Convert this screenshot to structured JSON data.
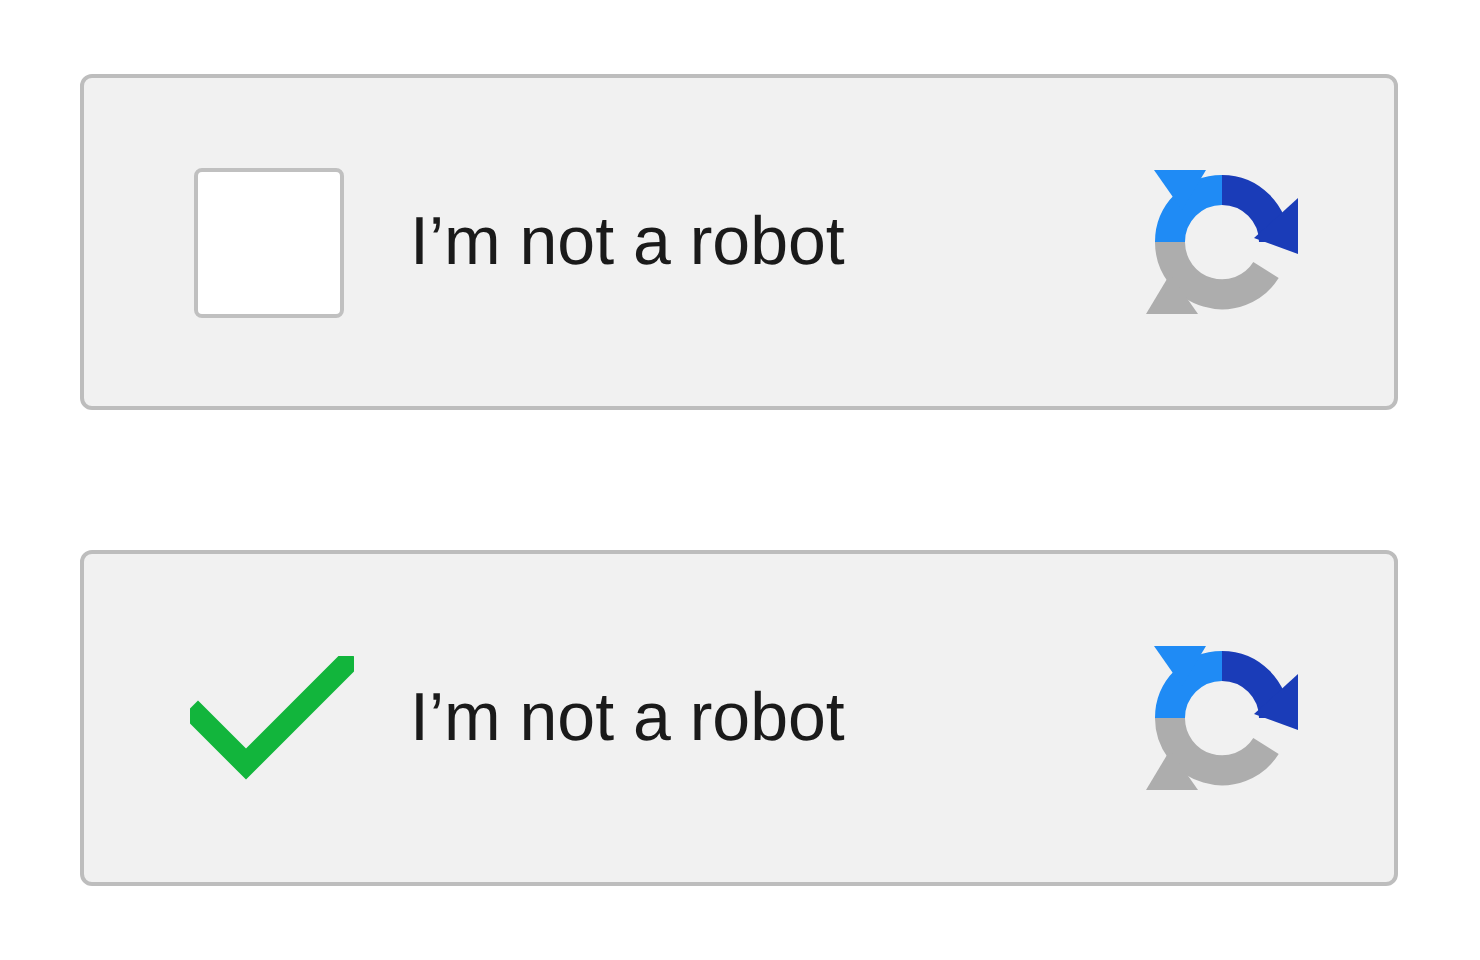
{
  "widgets": [
    {
      "label": "I’m not a robot",
      "checked": false
    },
    {
      "label": "I’m not a robot",
      "checked": true
    }
  ]
}
